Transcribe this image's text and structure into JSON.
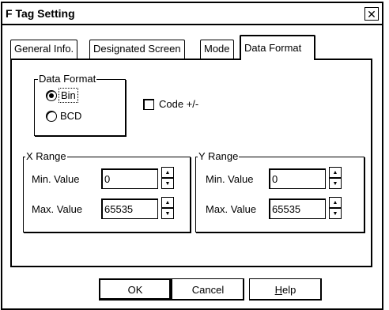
{
  "window": {
    "title": "F Tag Setting",
    "close_glyph": "✕"
  },
  "tabs": [
    {
      "label": "General Info."
    },
    {
      "label": "Designated Screen"
    },
    {
      "label": "Mode"
    },
    {
      "label": "Data Format",
      "active": true
    }
  ],
  "data_format_group": {
    "legend": "Data Format",
    "options": [
      {
        "label": "Bin",
        "selected": true
      },
      {
        "label": "BCD",
        "selected": false
      }
    ]
  },
  "code_checkbox": {
    "label": "Code +/-",
    "checked": false
  },
  "x_range": {
    "legend": "X Range",
    "min_label": "Min. Value",
    "min_value": "0",
    "max_label": "Max. Value",
    "max_value": "65535"
  },
  "y_range": {
    "legend": "Y Range",
    "min_label": "Min. Value",
    "min_value": "0",
    "max_label": "Max. Value",
    "max_value": "65535"
  },
  "buttons": {
    "ok": "OK",
    "cancel": "Cancel",
    "help_mnemonic": "H",
    "help_rest": "elp"
  },
  "icons": {
    "spin_up": "spin-up-arrow-icon",
    "spin_down": "spin-down-arrow-icon",
    "close": "close-icon"
  }
}
